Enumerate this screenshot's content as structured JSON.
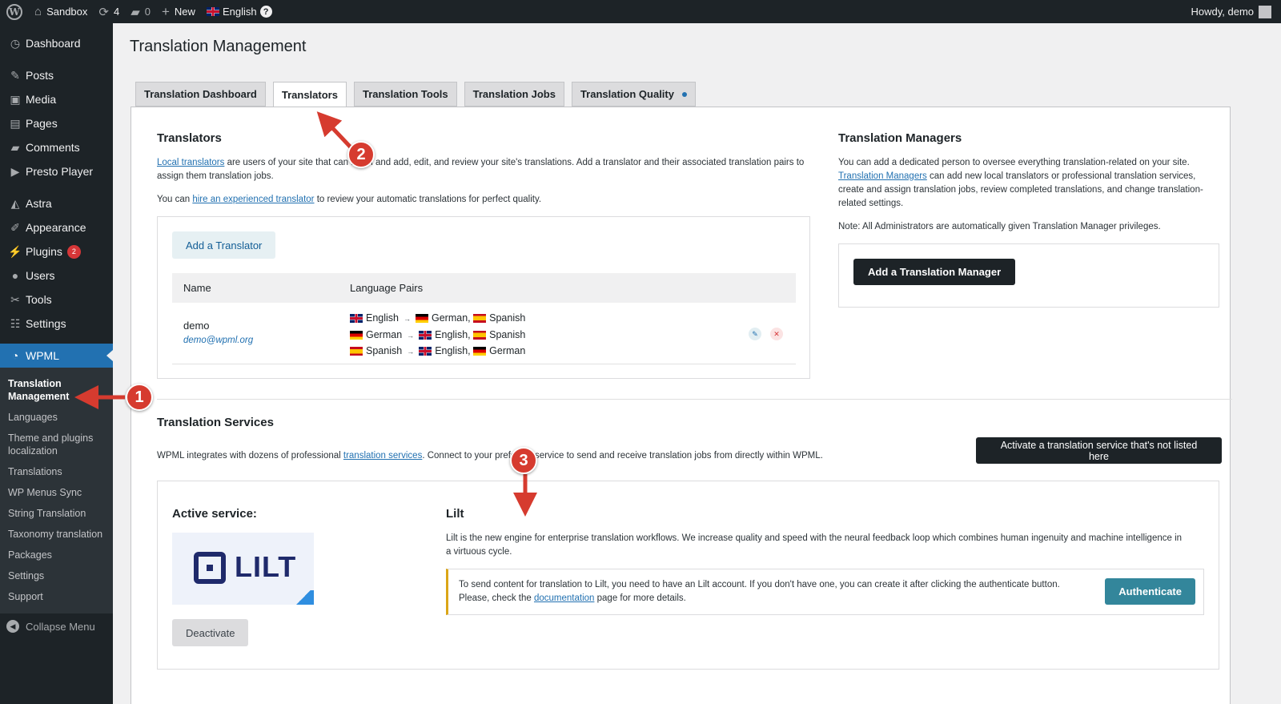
{
  "admin_bar": {
    "site_name": "Sandbox",
    "updates_count": "4",
    "comments_count": "0",
    "new_label": "New",
    "language_label": "English",
    "howdy": "Howdy, demo"
  },
  "sidebar": {
    "items": [
      {
        "label": "Dashboard",
        "icon": "dashboard-icon"
      },
      {
        "label": "Posts",
        "icon": "pin-icon"
      },
      {
        "label": "Media",
        "icon": "media-icon"
      },
      {
        "label": "Pages",
        "icon": "pages-icon"
      },
      {
        "label": "Comments",
        "icon": "comment-icon"
      },
      {
        "label": "Presto Player",
        "icon": "play-icon"
      },
      {
        "label": "Astra",
        "icon": "astra-icon"
      },
      {
        "label": "Appearance",
        "icon": "brush-icon"
      },
      {
        "label": "Plugins",
        "icon": "plugin-icon",
        "badge": "2"
      },
      {
        "label": "Users",
        "icon": "users-icon"
      },
      {
        "label": "Tools",
        "icon": "wrench-icon"
      },
      {
        "label": "Settings",
        "icon": "sliders-icon"
      },
      {
        "label": "WPML",
        "icon": "wpml-icon"
      }
    ],
    "submenu": [
      "Translation Management",
      "Languages",
      "Theme and plugins localization",
      "Translations",
      "WP Menus Sync",
      "String Translation",
      "Taxonomy translation",
      "Packages",
      "Settings",
      "Support"
    ],
    "collapse_label": "Collapse Menu"
  },
  "page": {
    "title": "Translation Management",
    "tabs": [
      {
        "label": "Translation Dashboard"
      },
      {
        "label": "Translators"
      },
      {
        "label": "Translation Tools"
      },
      {
        "label": "Translation Jobs"
      },
      {
        "label": "Translation Quality"
      }
    ]
  },
  "translators": {
    "heading": "Translators",
    "intro_link": "Local translators",
    "intro_rest": " are users of your site that can log in and add, edit, and review your site's translations. Add a translator and their associated translation pairs to assign them translation jobs.",
    "hire_prefix": "You can ",
    "hire_link": "hire an experienced translator",
    "hire_suffix": " to review your automatic translations for perfect quality.",
    "add_button": "Add a Translator",
    "col_name": "Name",
    "col_pairs": "Language Pairs",
    "row": {
      "name": "demo",
      "email": "demo@wpml.org",
      "pairs": [
        {
          "from": "English",
          "to1": "German,",
          "to2": "Spanish"
        },
        {
          "from": "German",
          "to1": "English,",
          "to2": "Spanish"
        },
        {
          "from": "Spanish",
          "to1": "English,",
          "to2": "German"
        }
      ]
    }
  },
  "managers": {
    "heading": "Translation Managers",
    "desc1": "You can add a dedicated person to oversee everything translation-related on your site.",
    "desc_link": "Translation Managers",
    "desc2": " can add new local translators or professional translation services, create and assign translation jobs, review completed translations, and change translation-related settings.",
    "note": "Note: All Administrators are automatically given Translation Manager privileges.",
    "add_button": "Add a Translation Manager"
  },
  "services": {
    "heading": "Translation Services",
    "desc_prefix": "WPML integrates with dozens of professional ",
    "desc_link": "translation services",
    "desc_suffix": ". Connect to your preferred service to send and receive translation jobs from directly within WPML.",
    "activate_button": "Activate a translation service that's not listed here",
    "active_label": "Active service:",
    "logo_text": "LILT",
    "deactivate_button": "Deactivate",
    "service_name": "Lilt",
    "service_desc": "Lilt is the new engine for enterprise translation workflows. We increase quality and speed with the neural feedback loop which combines human ingenuity and machine intelligence in a virtuous cycle.",
    "notice_line1": "To send content for translation to Lilt, you need to have an Lilt account. If you don't have one, you can create it after clicking the authenticate button.",
    "notice_prefix": "Please, check the ",
    "notice_link": "documentation",
    "notice_suffix": " page for more details.",
    "authenticate_button": "Authenticate"
  },
  "callouts": [
    "1",
    "2",
    "3"
  ],
  "colors": {
    "admin_dark": "#1d2327",
    "wp_blue": "#2271b1",
    "callout_red": "#d63b2f",
    "teal_button": "#33869b",
    "notice_yellow": "#dba617"
  }
}
